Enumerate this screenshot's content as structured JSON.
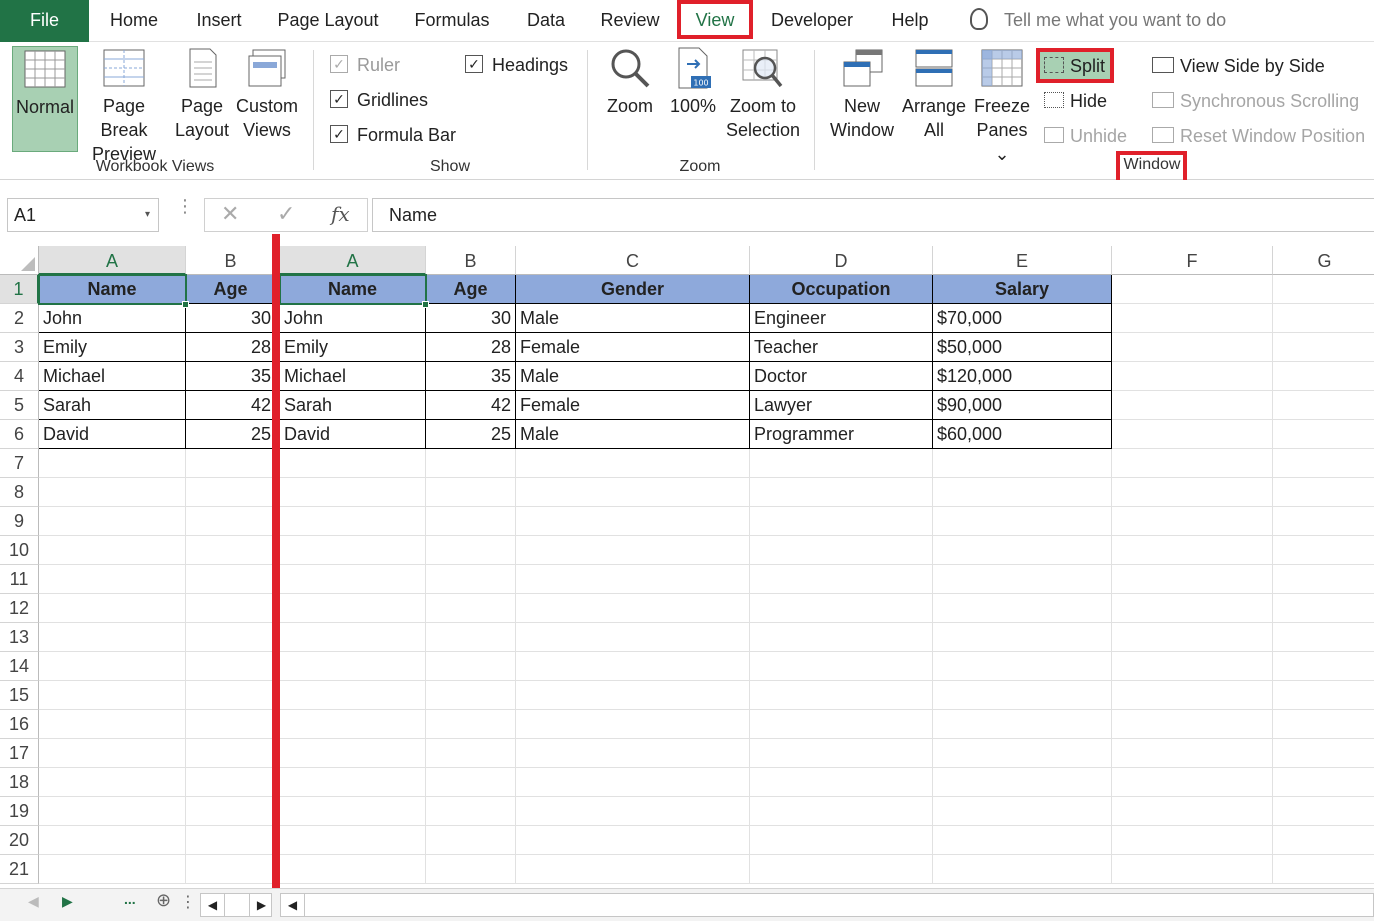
{
  "tabs": [
    "File",
    "Home",
    "Insert",
    "Page Layout",
    "Formulas",
    "Data",
    "Review",
    "View",
    "Developer",
    "Help"
  ],
  "tell_me": "Tell me what you want to do",
  "ribbon": {
    "workbook_views": {
      "label": "Workbook Views",
      "normal": "Normal",
      "page_break_1": "Page Break",
      "page_break_2": "Preview",
      "page_layout_1": "Page",
      "page_layout_2": "Layout",
      "custom_1": "Custom",
      "custom_2": "Views"
    },
    "show": {
      "label": "Show",
      "ruler": "Ruler",
      "gridlines": "Gridlines",
      "formula_bar": "Formula Bar",
      "headings": "Headings",
      "check": "✓"
    },
    "zoom": {
      "label": "Zoom",
      "zoom": "Zoom",
      "hundred": "100%",
      "zoom_sel_1": "Zoom to",
      "zoom_sel_2": "Selection",
      "badge": "100"
    },
    "window": {
      "label": "Window",
      "new_1": "New",
      "new_2": "Window",
      "arrange_1": "Arrange",
      "arrange_2": "All",
      "freeze_1": "Freeze",
      "freeze_2": "Panes",
      "freeze_caret": "⌄",
      "split": "Split",
      "hide": "Hide",
      "unhide": "Unhide",
      "side_by_side": "View Side by Side",
      "sync_scroll": "Synchronous Scrolling",
      "reset_pos": "Reset Window Position"
    }
  },
  "formula_bar": {
    "name_box": "A1",
    "dropdown": "▾",
    "dots": "⋮",
    "cancel": "✕",
    "enter": "✓",
    "fx": "fx",
    "content": "Name"
  },
  "grid": {
    "left_cols": [
      "A",
      "B"
    ],
    "right_cols": [
      "A",
      "B",
      "C",
      "D",
      "E",
      "F",
      "G"
    ],
    "rows": [
      "1",
      "2",
      "3",
      "4",
      "5",
      "6",
      "7",
      "8",
      "9",
      "10",
      "11",
      "12",
      "13",
      "14",
      "15",
      "16",
      "17",
      "18",
      "19",
      "20",
      "21"
    ],
    "header": [
      "Name",
      "Age",
      "Gender",
      "Occupation",
      "Salary"
    ],
    "data": [
      [
        "John",
        "30",
        "Male",
        "Engineer",
        "$70,000"
      ],
      [
        "Emily",
        "28",
        "Female",
        "Teacher",
        "$50,000"
      ],
      [
        "Michael",
        "35",
        "Male",
        "Doctor",
        "$120,000"
      ],
      [
        "Sarah",
        "42",
        "Female",
        "Lawyer",
        "$90,000"
      ],
      [
        "David",
        "25",
        "Male",
        "Programmer",
        "$60,000"
      ]
    ]
  },
  "bottom": {
    "prev": "◀",
    "next": "▶",
    "more": "...",
    "add": "⊕",
    "dots": "⋮",
    "left": "◀",
    "right": "▶"
  },
  "colors": {
    "accent": "#217346",
    "highlight": "#e0202a",
    "header_fill": "#8ea9db"
  }
}
